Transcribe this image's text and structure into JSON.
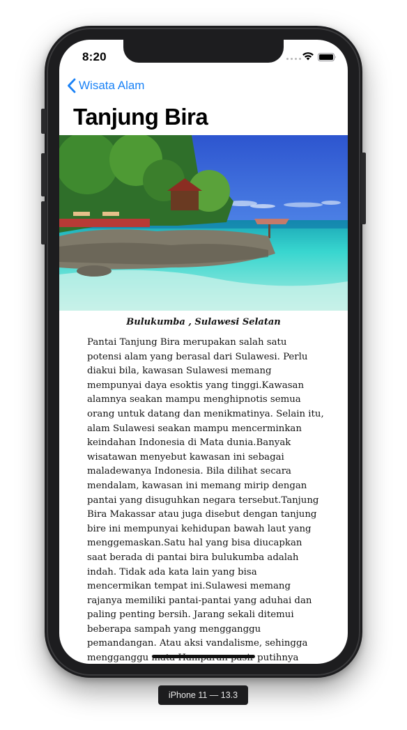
{
  "status_bar": {
    "time": "8:20"
  },
  "nav": {
    "back_label": "Wisata Alam",
    "title": "Tanjung Bira"
  },
  "article": {
    "caption": "Bulukumba , Sulawesi Selatan",
    "body": "Pantai Tanjung Bira merupakan salah satu potensi alam yang berasal dari Sulawesi. Perlu diakui bila, kawasan Sulawesi memang mempunyai daya esoktis yang tinggi.Kawasan alamnya seakan mampu menghipnotis semua orang untuk datang dan menikmatinya. Selain itu, alam Sulawesi seakan mampu mencerminkan keindahan Indonesia di Mata dunia.Banyak wisatawan menyebut kawasan ini sebagai maladewanya Indonesia. Bila dilihat secara mendalam, kawasan ini memang mirip dengan pantai yang disuguhkan negara tersebut.Tanjung Bira Makassar atau juga disebut dengan tanjung bire ini mempunyai kehidupan bawah laut  yang menggemaskan.Satu hal yang bisa diucapkan saat berada di pantai bira bulukumba adalah indah. Tidak ada kata lain yang bisa mencermikan tempat ini.Sulawesi memang rajanya memiliki pantai-pantai yang aduhai dan paling penting bersih. Jarang sekali ditemui beberapa sampah yang mengganggu pemandangan. Atau aksi vandalisme, sehingga mengganggu mata Hamparan pasir putihnya sungguh mempesona."
  },
  "device": {
    "label": "iPhone 11 — 13.3"
  },
  "colors": {
    "accent": "#1a82f6",
    "frame": "#1d1d1f"
  },
  "icons": {
    "back": "chevron-left-icon",
    "wifi": "wifi-icon",
    "battery": "battery-icon",
    "signal": "signal-icon"
  }
}
